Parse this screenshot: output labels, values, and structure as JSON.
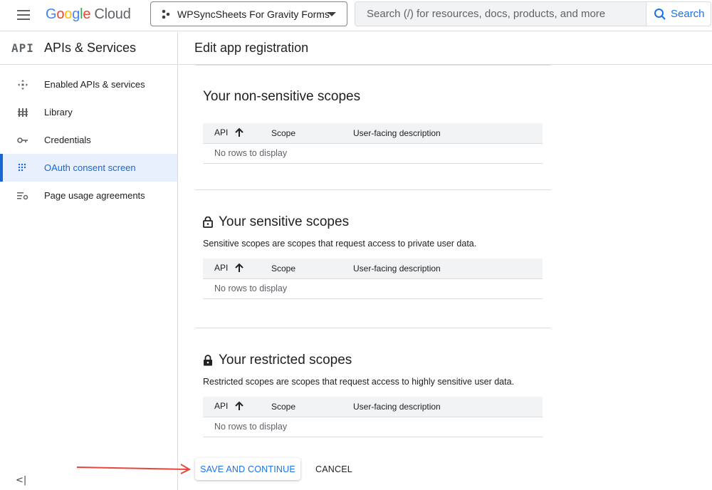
{
  "header": {
    "logo_google": [
      "G",
      "o",
      "o",
      "g",
      "l",
      "e"
    ],
    "logo_cloud": "Cloud",
    "project_name": "WPSyncSheets For Gravity Forms",
    "search_placeholder": "Search (/) for resources, docs, products, and more",
    "search_button": "Search"
  },
  "sidebar": {
    "api_logo": "API",
    "title": "APIs & Services",
    "items": [
      {
        "label": "Enabled APIs & services",
        "icon": "apis-icon",
        "active": false
      },
      {
        "label": "Library",
        "icon": "library-icon",
        "active": false
      },
      {
        "label": "Credentials",
        "icon": "key-icon",
        "active": false
      },
      {
        "label": "OAuth consent screen",
        "icon": "consent-icon",
        "active": true
      },
      {
        "label": "Page usage agreements",
        "icon": "settings-list-icon",
        "active": false
      }
    ],
    "collapse_label": "<|"
  },
  "main": {
    "title": "Edit app registration",
    "sections": [
      {
        "title": "Your non-sensitive scopes",
        "icon": null,
        "description": "",
        "columns": [
          "API",
          "Scope",
          "User-facing description"
        ],
        "empty_text": "No rows to display"
      },
      {
        "title": "Your sensitive scopes",
        "icon": "lock-open-icon",
        "description": "Sensitive scopes are scopes that request access to private user data.",
        "columns": [
          "API",
          "Scope",
          "User-facing description"
        ],
        "empty_text": "No rows to display"
      },
      {
        "title": "Your restricted scopes",
        "icon": "lock-icon",
        "description": "Restricted scopes are scopes that request access to highly sensitive user data.",
        "columns": [
          "API",
          "Scope",
          "User-facing description"
        ],
        "empty_text": "No rows to display"
      }
    ],
    "save_button": "SAVE AND CONTINUE",
    "cancel_button": "CANCEL"
  },
  "colors": {
    "accent": "#1a73e8",
    "active_bg": "#e8f0fe",
    "annotation_arrow": "#e8473f"
  }
}
